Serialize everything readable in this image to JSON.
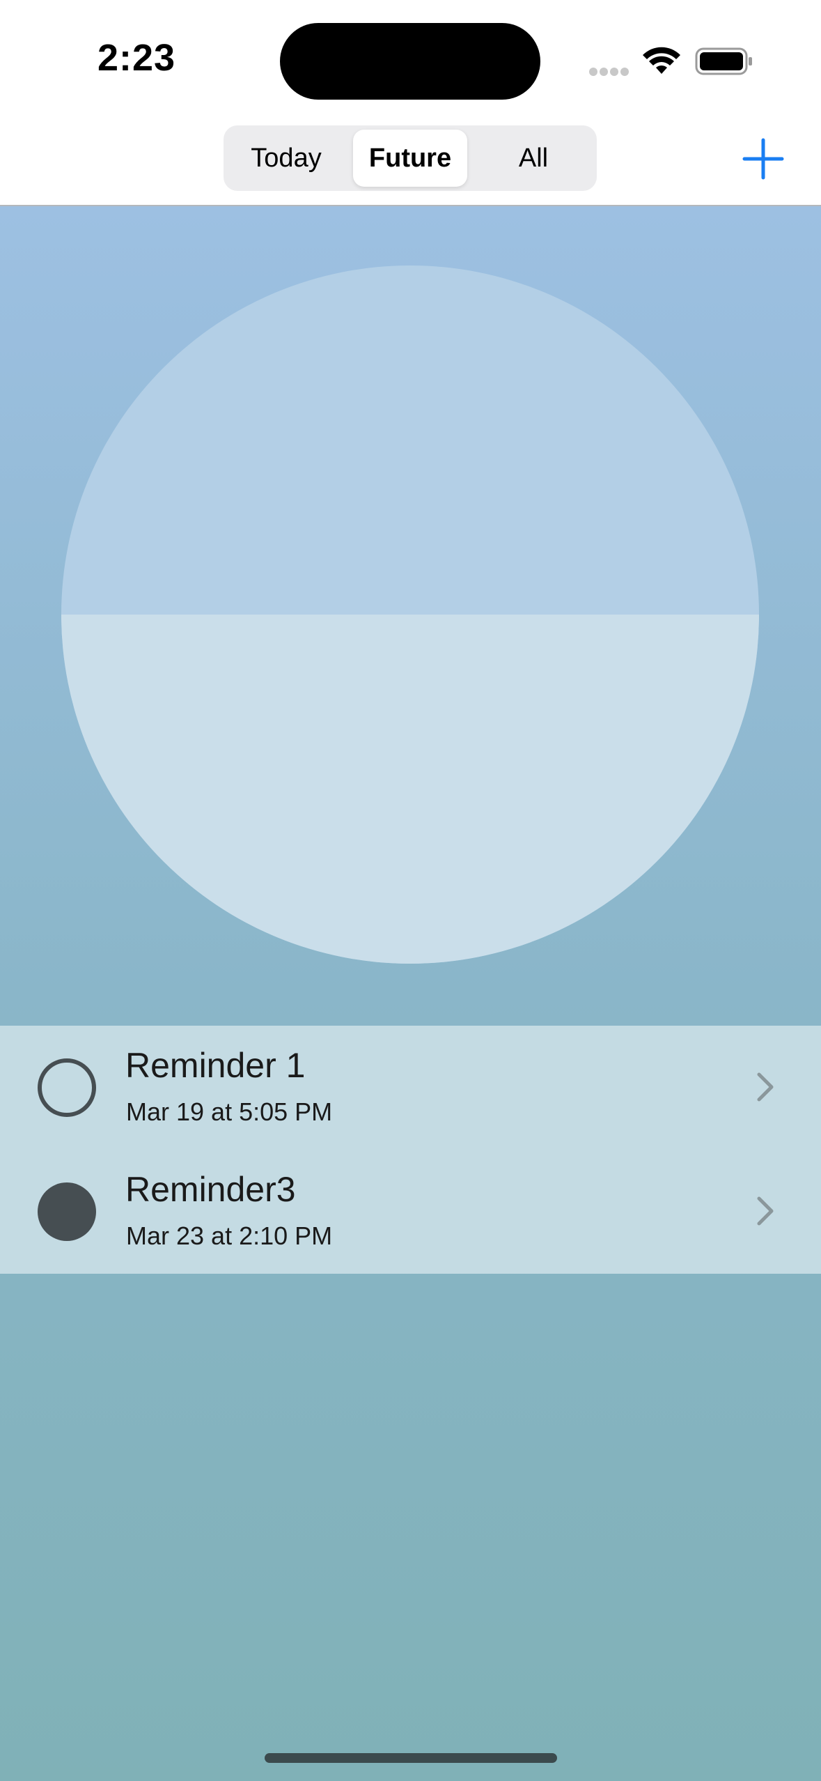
{
  "status_bar": {
    "time": "2:23"
  },
  "segmented_control": {
    "segments": [
      {
        "label": "Today",
        "selected": false
      },
      {
        "label": "Future",
        "selected": true
      },
      {
        "label": "All",
        "selected": false
      }
    ]
  },
  "toolbar": {
    "add_icon": "plus-icon"
  },
  "progress": {
    "fraction": 0.5
  },
  "reminders": [
    {
      "title": "Reminder 1",
      "date": "Mar 19 at 5:05 PM",
      "completed": false
    },
    {
      "title": "Reminder3",
      "date": "Mar 23 at 2:10 PM",
      "completed": true
    }
  ],
  "colors": {
    "accent": "#1a7ef2",
    "check": "#464e52",
    "list_background": "#c4dbe3"
  }
}
